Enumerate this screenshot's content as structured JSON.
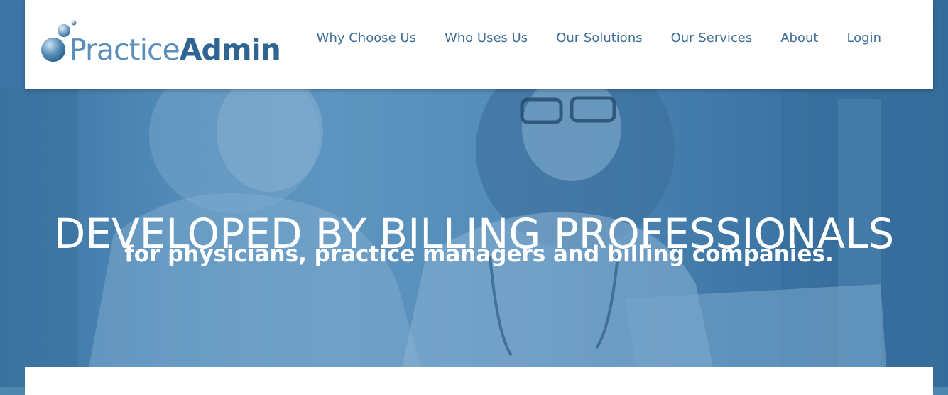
{
  "brand": {
    "name_light": "Practice",
    "name_bold": "Admin",
    "colors": {
      "light": "#5b8fba",
      "dark": "#2f6592"
    }
  },
  "nav": {
    "items": [
      {
        "label": "Why Choose Us"
      },
      {
        "label": "Who Uses Us"
      },
      {
        "label": "Our Solutions"
      },
      {
        "label": "Our Services"
      },
      {
        "label": "About"
      },
      {
        "label": "Login"
      }
    ]
  },
  "hero": {
    "headline": "DEVELOPED BY BILLING PROFESSIONALS",
    "subheadline": "for physicians, practice managers and billing companies."
  }
}
